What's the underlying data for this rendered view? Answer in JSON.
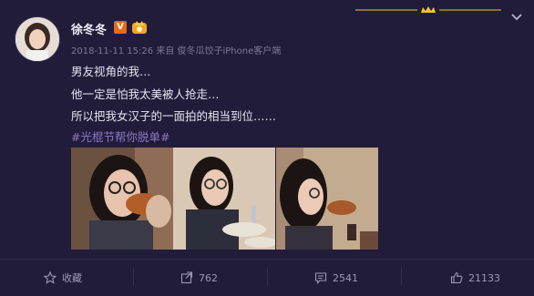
{
  "post": {
    "author": "徐冬冬",
    "verified_badge": "V",
    "timestamp": "2018-11-11 15:26",
    "source": "来自 俊冬瓜饺子iPhone客户端",
    "lines": [
      "男友视角的我…",
      "他一定是怕我太美被人抢走…",
      "所以把我女汉子的一面拍的相当到位……"
    ],
    "hashtag": "#光棍节帮你脱单#"
  },
  "actions": {
    "favorite_label": "收藏",
    "repost_count": "762",
    "comment_count": "2541",
    "like_count": "21133"
  },
  "colors": {
    "background": "#211c3a",
    "hashtag": "#8e79c4",
    "verified_badge": "#e86a14",
    "ornament": "#f2c23a"
  }
}
